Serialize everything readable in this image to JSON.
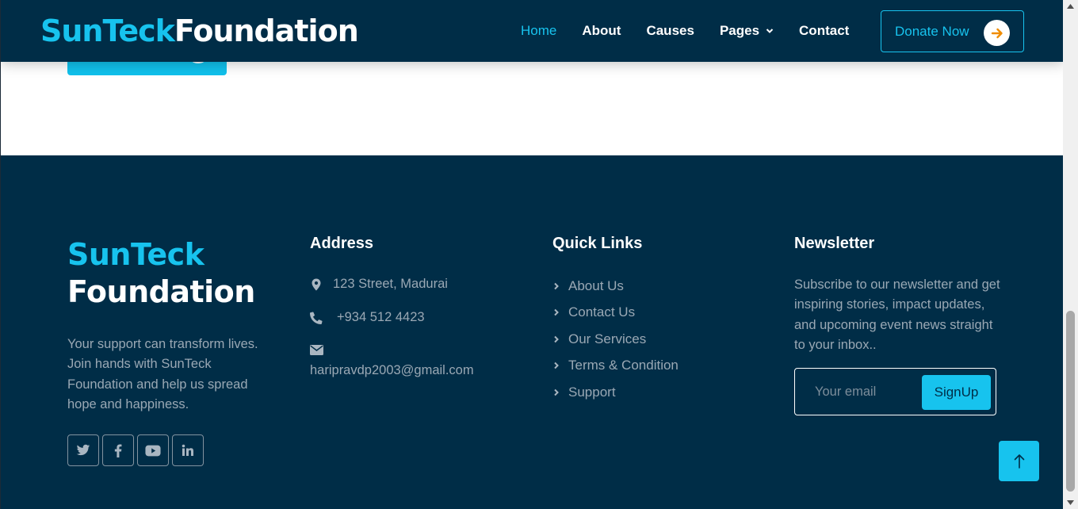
{
  "header": {
    "logo_part1": "SunTeck",
    "logo_part2": "Foundation",
    "nav": [
      {
        "label": "Home",
        "active": true
      },
      {
        "label": "About"
      },
      {
        "label": "Causes"
      },
      {
        "label": "Pages",
        "dropdown": true
      },
      {
        "label": "Contact"
      }
    ],
    "donate_label": "Donate Now"
  },
  "footer": {
    "brand_line1": "SunTeck",
    "brand_line2": "Foundation",
    "brand_text": "Your support can transform lives. Join hands with SunTeck Foundation and help us spread hope and happiness.",
    "socials": [
      "twitter-icon",
      "facebook-icon",
      "youtube-icon",
      "linkedin-icon"
    ],
    "address": {
      "title": "Address",
      "street": "123 Street, Madurai",
      "phone": "+934 512 4423",
      "email": "haripravdp2003@gmail.com"
    },
    "quick_links": {
      "title": "Quick Links",
      "items": [
        "About Us",
        "Contact Us",
        "Our Services",
        "Terms & Condition",
        "Support"
      ]
    },
    "newsletter": {
      "title": "Newsletter",
      "text": "Subscribe to our newsletter and get inspiring stories, impact updates, and upcoming event news straight to your inbox..",
      "placeholder": "Your email",
      "button": "SignUp"
    }
  },
  "colors": {
    "navy": "#002d47",
    "accent": "#17c3ee",
    "donate_arrow": "#f08c00",
    "muted_text": "#9aa8b4"
  }
}
